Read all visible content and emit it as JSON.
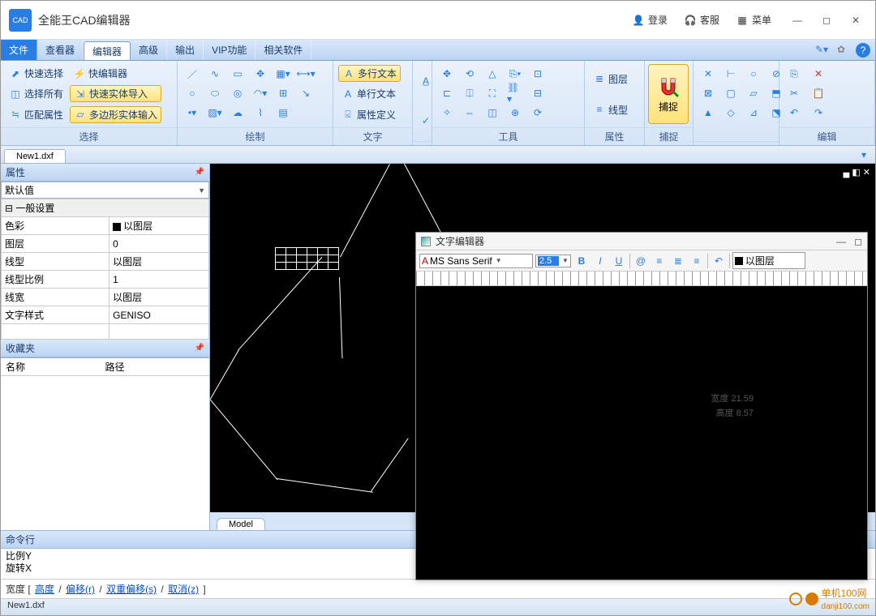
{
  "app": {
    "title": "全能王CAD编辑器",
    "logo": "CAD"
  },
  "titlebar": {
    "login": "登录",
    "service": "客服",
    "menu": "菜单"
  },
  "menu": {
    "tabs": [
      "文件",
      "查看器",
      "编辑器",
      "高级",
      "输出",
      "VIP功能",
      "相关软件"
    ]
  },
  "ribbon": {
    "select": {
      "label": "选择",
      "quick": "快速选择",
      "all": "选择所有",
      "match": "匹配属性",
      "quickedit": "快编辑器",
      "import": "快速实体导入",
      "poly": "多边形实体输入"
    },
    "draw": {
      "label": "绘制"
    },
    "text": {
      "label": "文字",
      "multi": "多行文本",
      "single": "单行文本",
      "attr": "属性定义"
    },
    "tools": {
      "label": "工具"
    },
    "props": {
      "label": "属性",
      "layer": "图层",
      "linetype": "线型"
    },
    "snap": {
      "label": "捕捉",
      "btn": "捕捉"
    },
    "edit": {
      "label": "编辑"
    }
  },
  "doc": {
    "tab": "New1.dxf"
  },
  "propPanel": {
    "title": "属性",
    "default": "默认值",
    "group": "一般设置",
    "rows": [
      [
        "色彩",
        "以图层"
      ],
      [
        "图层",
        "0"
      ],
      [
        "线型",
        "以图层"
      ],
      [
        "线型比例",
        "1"
      ],
      [
        "线宽",
        "以图层"
      ],
      [
        "文字样式",
        "GENISO"
      ]
    ]
  },
  "fav": {
    "title": "收藏夹",
    "col1": "名称",
    "col2": "路径"
  },
  "model": {
    "tab": "Model"
  },
  "cmd": {
    "title": "命令行",
    "line1": "比例Y",
    "line2": "旋转X",
    "prompt_a": "宽度 [ ",
    "links": [
      "高度",
      "偏移(r)",
      "双重偏移(s)",
      "取消(z)"
    ],
    "prompt_b": " ]"
  },
  "status": {
    "file": "New1.dxf"
  },
  "textedit": {
    "title": "文字编辑器",
    "font": "MS Sans Serif",
    "size": "2.5",
    "layer": "以图层",
    "dim1": "宽度  21.59",
    "dim2": "高度  8.57"
  },
  "watermark": {
    "name": "单机100网",
    "url": "danji100.com"
  }
}
